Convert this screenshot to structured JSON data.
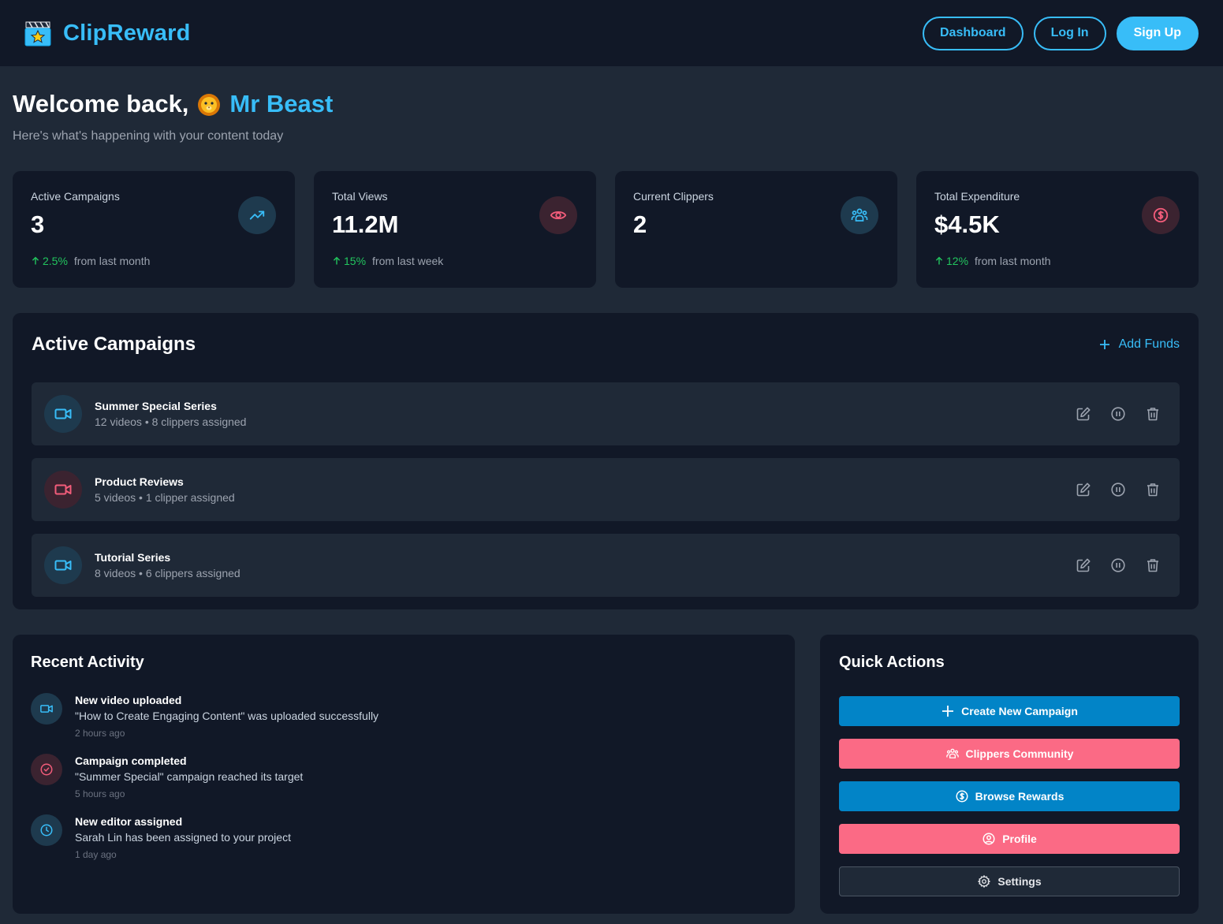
{
  "app": {
    "name": "ClipReward"
  },
  "nav": {
    "dashboard": "Dashboard",
    "login": "Log In",
    "signup": "Sign Up"
  },
  "welcome": {
    "greeting": "Welcome back,",
    "user": "Mr Beast",
    "subtitle": "Here's what's happening with your content today"
  },
  "stats": [
    {
      "label": "Active Campaigns",
      "value": "3",
      "trend": "2.5%",
      "trend_text": "from last month",
      "icon": "trending-up-icon"
    },
    {
      "label": "Total Views",
      "value": "11.2M",
      "trend": "15%",
      "trend_text": "from last week",
      "icon": "eye-icon"
    },
    {
      "label": "Current Clippers",
      "value": "2",
      "trend": "",
      "trend_text": "",
      "icon": "users-icon"
    },
    {
      "label": "Total Expenditure",
      "value": "$4.5K",
      "trend": "12%",
      "trend_text": "from last month",
      "icon": "dollar-icon"
    }
  ],
  "campaigns": {
    "title": "Active Campaigns",
    "add_funds": "Add Funds",
    "items": [
      {
        "name": "Summer Special Series",
        "meta": "12 videos • 8 clippers assigned",
        "color": "#38bdf8"
      },
      {
        "name": "Product Reviews",
        "meta": "5 videos • 1 clipper assigned",
        "color": "#f25c7a"
      },
      {
        "name": "Tutorial Series",
        "meta": "8 videos • 6 clippers assigned",
        "color": "#38bdf8"
      }
    ]
  },
  "activity": {
    "title": "Recent Activity",
    "items": [
      {
        "title": "New video uploaded",
        "desc": "\"How to Create Engaging Content\" was uploaded successfully",
        "time": "2 hours ago",
        "icon": "video-icon"
      },
      {
        "title": "Campaign completed",
        "desc": "\"Summer Special\" campaign reached its target",
        "time": "5 hours ago",
        "icon": "check-circle-icon"
      },
      {
        "title": "New editor assigned",
        "desc": "Sarah Lin has been assigned to your project",
        "time": "1 day ago",
        "icon": "clock-icon"
      }
    ]
  },
  "quick_actions": {
    "title": "Quick Actions",
    "create": "Create New Campaign",
    "community": "Clippers Community",
    "rewards": "Browse Rewards",
    "profile": "Profile",
    "settings": "Settings"
  },
  "colors": {
    "accent": "#38bdf8",
    "pink": "#fb6a85",
    "blue_button": "#0284c7",
    "success": "#22c55e"
  }
}
